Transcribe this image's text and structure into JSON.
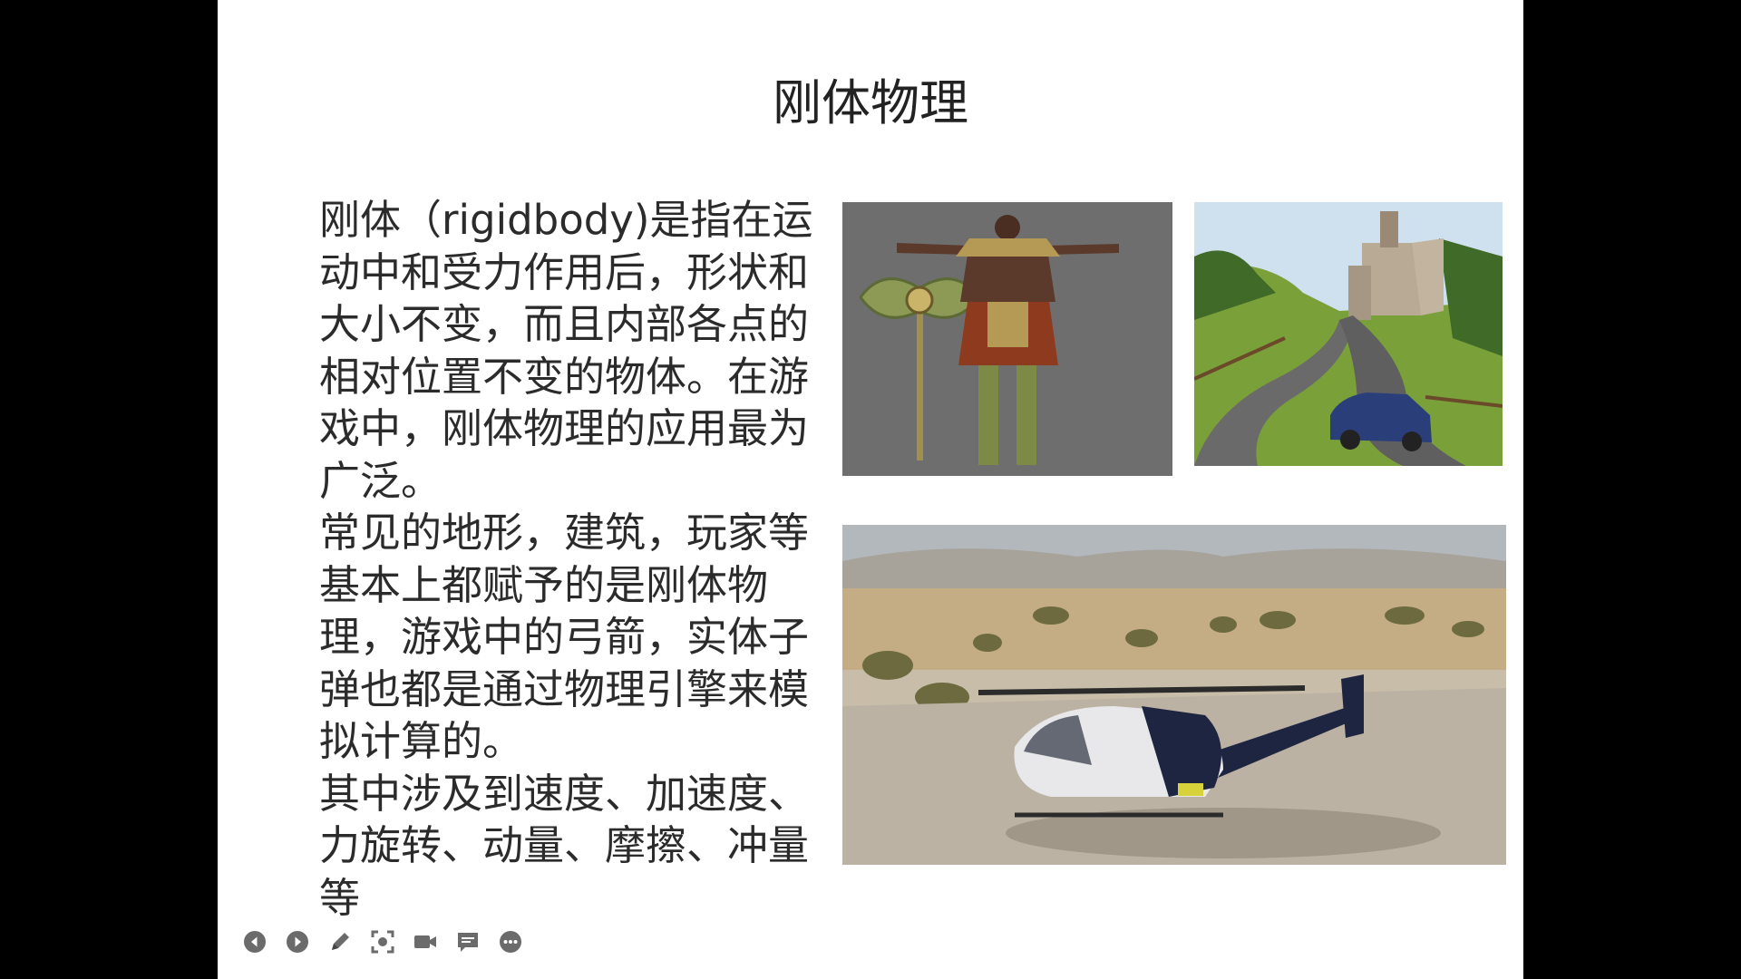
{
  "slide": {
    "title": "刚体物理",
    "paragraphs": [
      "刚体（rigidbody)是指在运动中和受力作用后，形状和大小不变，而且内部各点的相对位置不变的物体。在游戏中，刚体物理的应用最为广泛。",
      "常见的地形，建筑，玩家等基本上都赋予的是刚体物理，游戏中的弓箭，实体子弹也都是通过物理引擎来模拟计算的。",
      "其中涉及到速度、加速度、力旋转、动量、摩擦、冲量等"
    ],
    "images": [
      {
        "subject": "armored warrior character holding a battle axe"
      },
      {
        "subject": "castle on a hill with a winding road and blue car"
      },
      {
        "subject": "helicopter parked on a desert airfield"
      }
    ]
  },
  "toolbar": {
    "buttons": [
      {
        "icon": "previous-icon"
      },
      {
        "icon": "next-icon"
      },
      {
        "icon": "pen-icon"
      },
      {
        "icon": "focus-icon"
      },
      {
        "icon": "camera-icon"
      },
      {
        "icon": "comment-icon"
      },
      {
        "icon": "more-icon"
      }
    ],
    "icon_color": "#6b6b6b"
  },
  "colors": {
    "background": "#000000",
    "slide": "#ffffff",
    "text": "#2b2b2b"
  }
}
